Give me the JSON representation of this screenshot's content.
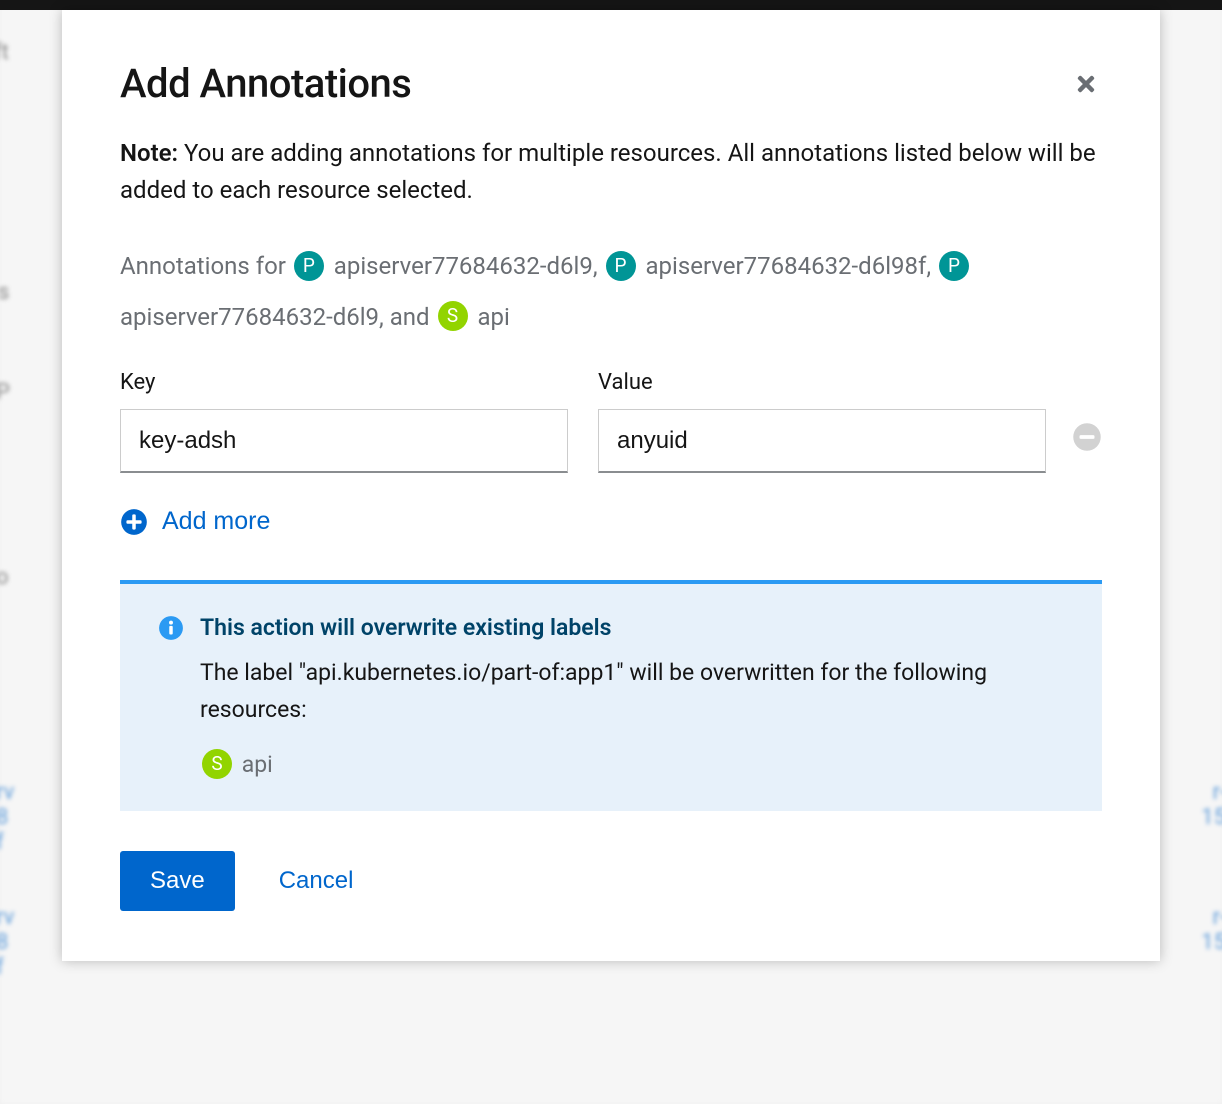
{
  "modal": {
    "title": "Add Annotations",
    "note_prefix": "Note:",
    "note_text": " You are adding annotations for multiple resources. All annotations listed below will be added to each resource selected.",
    "annotations_for_label": "Annotations for",
    "resources": [
      {
        "badge": "P",
        "badge_type": "p",
        "name": "apiserver77684632-d6l9",
        "suffix": ","
      },
      {
        "badge": "P",
        "badge_type": "p",
        "name": "apiserver77684632-d6l98f",
        "suffix": ","
      },
      {
        "badge": "P",
        "badge_type": "p",
        "name": "apiserver77684632-d6l9",
        "suffix": ", and"
      },
      {
        "badge": "S",
        "badge_type": "s",
        "name": "api",
        "suffix": ""
      }
    ],
    "form": {
      "key_label": "Key",
      "value_label": "Value",
      "rows": [
        {
          "key": "key-adsh",
          "value": "anyuid"
        }
      ],
      "add_more_label": "Add more"
    },
    "alert": {
      "title": "This action will overwrite existing labels",
      "body": "The label \"api.kubernetes.io/part-of:app1\" will be overwritten for the following resources:",
      "resources": [
        {
          "badge": "S",
          "badge_type": "s",
          "name": "api"
        }
      ]
    },
    "footer": {
      "save_label": "Save",
      "cancel_label": "Cancel"
    }
  }
}
